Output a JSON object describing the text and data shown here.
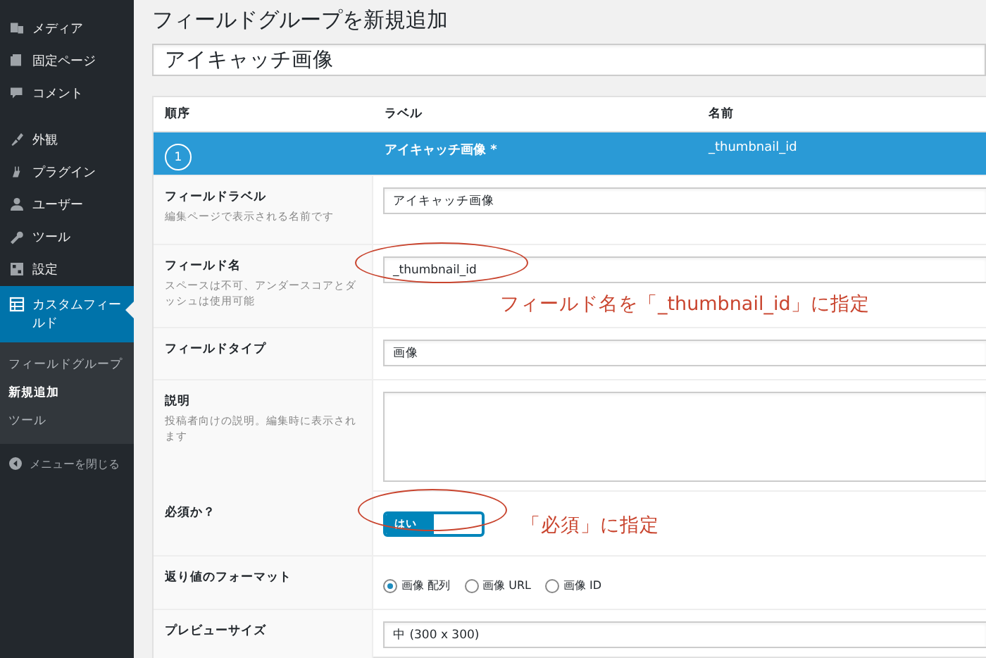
{
  "sidebar": {
    "menu_groups": [
      [
        {
          "label": "メディア",
          "selected": false
        },
        {
          "label": "固定ページ",
          "selected": false
        },
        {
          "label": "コメント",
          "selected": false
        }
      ],
      [
        {
          "label": "外観",
          "selected": false
        },
        {
          "label": "プラグイン",
          "selected": false
        },
        {
          "label": "ユーザー",
          "selected": false
        },
        {
          "label": "ツール",
          "selected": false
        },
        {
          "label": "設定",
          "selected": false
        },
        {
          "label": "カスタムフィールド",
          "selected": true
        }
      ]
    ],
    "submenu": [
      {
        "label": "フィールドグループ",
        "selected": false
      },
      {
        "label": "新規追加",
        "selected": true
      },
      {
        "label": "ツール",
        "selected": false
      }
    ],
    "collapse": "メニューを閉じる"
  },
  "page_title": "フィールドグループを新規追加",
  "group_title": "アイキャッチ画像",
  "table": {
    "columns": [
      "順序",
      "ラベル",
      "名前"
    ],
    "field": {
      "order": "1",
      "label": "アイキャッチ画像 *",
      "name": "_thumbnail_id"
    }
  },
  "settings": [
    {
      "kind": "text",
      "label": "フィールドラベル",
      "description": "編集ページで表示される名前です",
      "value": "アイキャッチ画像"
    },
    {
      "kind": "text",
      "label": "フィールド名",
      "description": "スペースは不可、アンダースコアとダッシュは使用可能",
      "value": "_thumbnail_id"
    },
    {
      "kind": "select",
      "label": "フィールドタイプ",
      "value": "画像"
    },
    {
      "kind": "textarea",
      "label": "説明",
      "description": "投稿者向けの説明。編集時に表示されます"
    },
    {
      "kind": "toggle",
      "label": "必須か？",
      "on": true,
      "toggle_text": "はい"
    },
    {
      "kind": "radio",
      "label": "返り値のフォーマット",
      "options": [
        {
          "label": "画像 配列",
          "selected": true
        },
        {
          "label": "画像 URL",
          "selected": false
        },
        {
          "label": "画像 ID",
          "selected": false
        }
      ]
    },
    {
      "kind": "select",
      "label": "プレビューサイズ",
      "value": "中 (300 x 300)"
    }
  ],
  "annotations": [
    {
      "text": "フィールド名を「_thumbnail_id」に指定"
    },
    {
      "text": "「必須」に指定"
    }
  ]
}
